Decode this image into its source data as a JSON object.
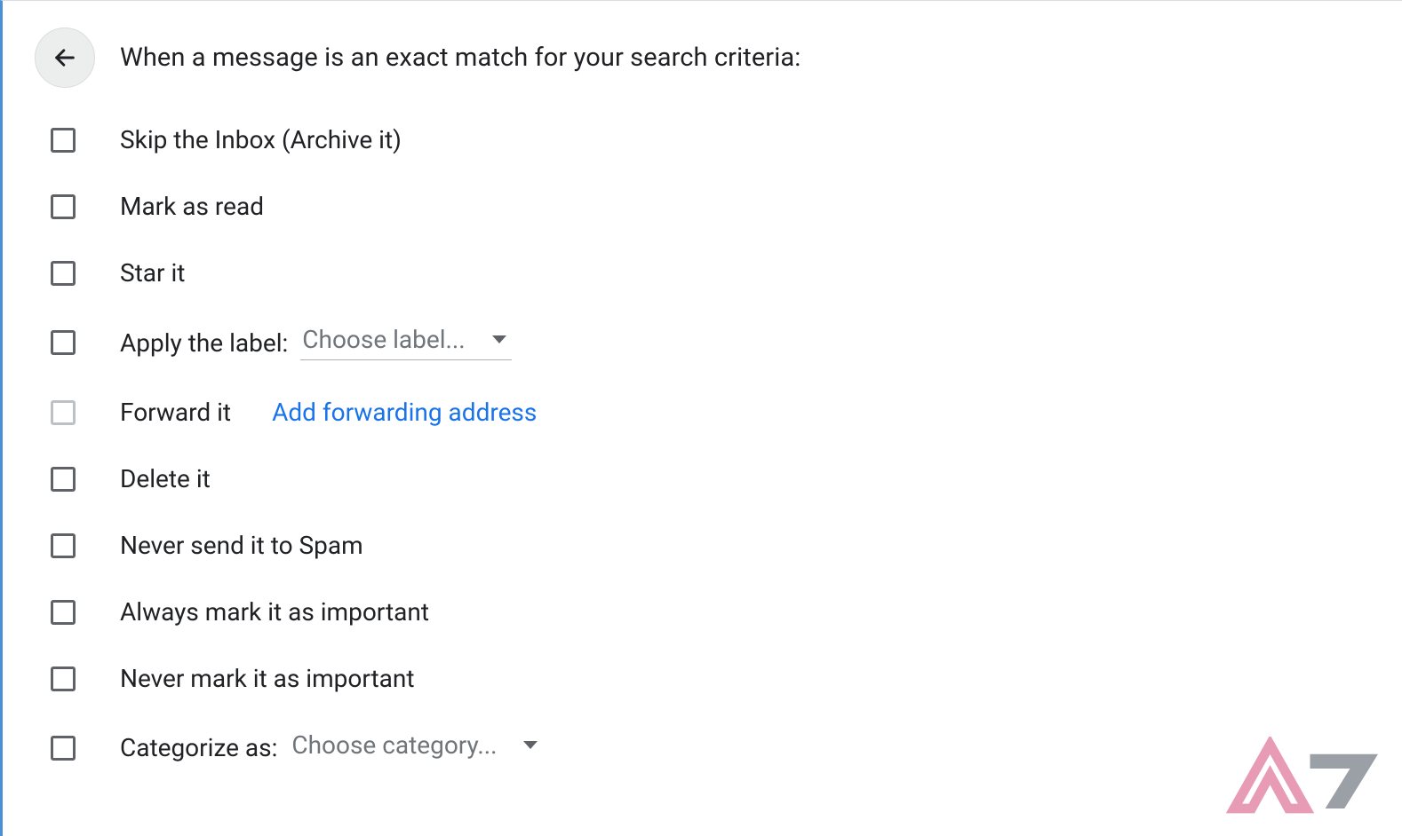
{
  "header": {
    "title": "When a message is an exact match for your search criteria:"
  },
  "options": {
    "skip_inbox": "Skip the Inbox (Archive it)",
    "mark_read": "Mark as read",
    "star_it": "Star it",
    "apply_label": "Apply the label:",
    "apply_label_placeholder": "Choose label...",
    "forward_it": "Forward it",
    "forward_link": "Add forwarding address",
    "delete_it": "Delete it",
    "never_spam": "Never send it to Spam",
    "always_important": "Always mark it as important",
    "never_important": "Never mark it as important",
    "categorize_as": "Categorize as:",
    "categorize_placeholder": "Choose category..."
  }
}
